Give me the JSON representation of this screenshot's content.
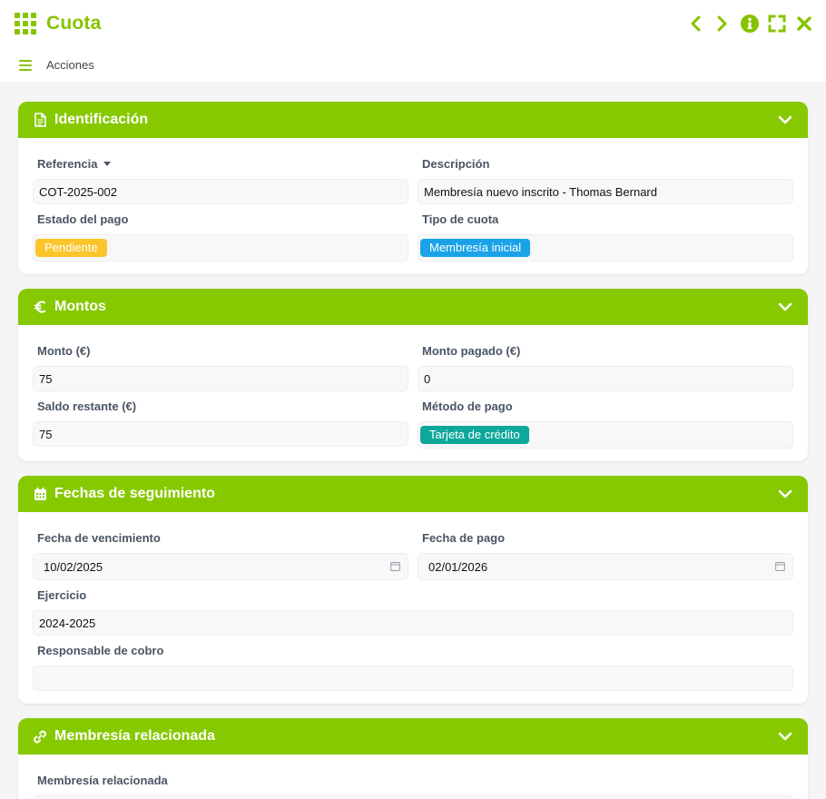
{
  "window": {
    "title": "Cuota"
  },
  "toolbar": {
    "actions_label": "Acciones"
  },
  "sections": {
    "identificacion": {
      "title": "Identificación",
      "referencia_label": "Referencia",
      "referencia_value": "COT-2025-002",
      "descripcion_label": "Descripción",
      "descripcion_value": "Membresía nuevo inscrito - Thomas Bernard",
      "estado_label": "Estado del pago",
      "estado_value": "Pendiente",
      "estado_color": "#fcc52c",
      "tipo_label": "Tipo de cuota",
      "tipo_value": "Membresía inicial",
      "tipo_color": "#1aa3e8"
    },
    "montos": {
      "title": "Montos",
      "monto_label": "Monto (€)",
      "monto_value": "75",
      "pagado_label": "Monto pagado (€)",
      "pagado_value": "0",
      "saldo_label": "Saldo restante (€)",
      "saldo_value": "75",
      "metodo_label": "Método de pago",
      "metodo_value": "Tarjeta de crédito",
      "metodo_color": "#0ea89a"
    },
    "fechas": {
      "title": "Fechas de seguimiento",
      "vencimiento_label": "Fecha de vencimiento",
      "vencimiento_value": "10/02/2025",
      "pago_label": "Fecha de pago",
      "pago_value": "02/01/2026",
      "ejercicio_label": "Ejercicio",
      "ejercicio_value": "2024-2025",
      "responsable_label": "Responsable de cobro",
      "responsable_value": ""
    },
    "membresia": {
      "title": "Membresía relacionada",
      "membresia_label": "Membresía relacionada"
    }
  },
  "colors": {
    "accent": "#86c900",
    "title_accent": "#86c300"
  }
}
